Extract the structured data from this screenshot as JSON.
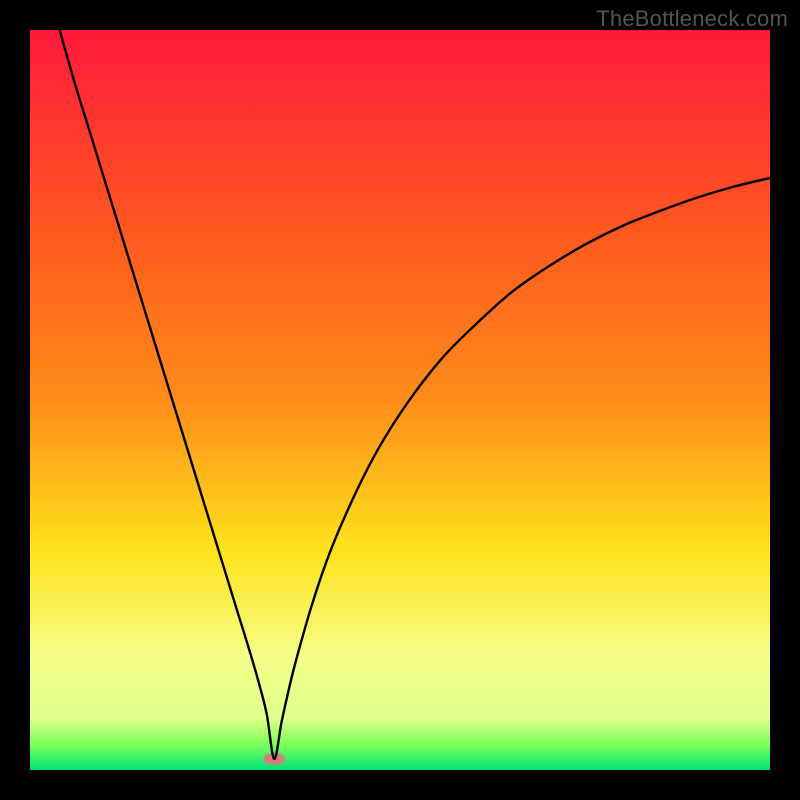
{
  "watermark": "TheBottleneck.com",
  "chart_data": {
    "type": "line",
    "title": "",
    "xlabel": "",
    "ylabel": "",
    "xlim": [
      0,
      100
    ],
    "ylim": [
      0,
      100
    ],
    "grid": false,
    "legend": false,
    "background_gradient": {
      "top": "#ff1a3a",
      "mid_upper": "#ff8c1a",
      "mid": "#ffe11a",
      "mid_lower": "#f5ff8a",
      "green_band": "#7dff59",
      "bottom": "#00e676"
    },
    "marker": {
      "x": 33,
      "y": 1.5,
      "color": "#d4807f",
      "rx": 11,
      "ry": 6
    },
    "series": [
      {
        "name": "curve",
        "color": "#000000",
        "x": [
          4,
          6,
          8,
          10,
          12,
          14,
          16,
          18,
          20,
          22,
          24,
          26,
          28,
          29,
          30,
          31,
          32,
          33,
          34,
          35,
          36,
          38,
          40,
          42,
          45,
          48,
          52,
          56,
          60,
          65,
          70,
          75,
          80,
          85,
          90,
          95,
          100
        ],
        "y": [
          100,
          93,
          86.5,
          80,
          73.5,
          67,
          60.5,
          54,
          47.5,
          41,
          34.5,
          28,
          21.5,
          18.3,
          15,
          11.5,
          7.5,
          1.5,
          6.5,
          11,
          15,
          22,
          28,
          33,
          39.5,
          45,
          51,
          56,
          60,
          64.5,
          68,
          71,
          73.5,
          75.5,
          77.3,
          78.8,
          80
        ]
      }
    ]
  }
}
